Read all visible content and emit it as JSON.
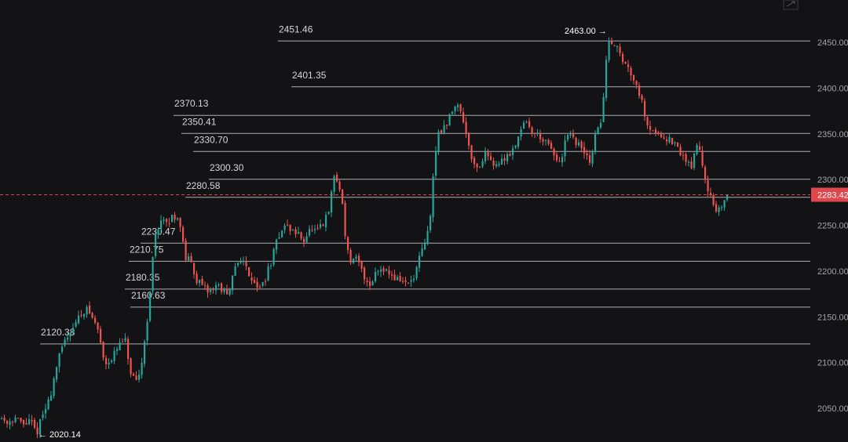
{
  "chart_data": {
    "type": "candlestick",
    "ylim": [
      2020,
      2470
    ],
    "y_ticks": [
      "2050.00",
      "2100.00",
      "2150.00",
      "2200.00",
      "2250.00",
      "2300.00",
      "2350.00",
      "2400.00",
      "2450.00"
    ],
    "horizontal_levels": [
      {
        "label": "2451.46",
        "value": 2451.46
      },
      {
        "label": "2401.35",
        "value": 2401.35
      },
      {
        "label": "2370.13",
        "value": 2370.13
      },
      {
        "label": "2350.41",
        "value": 2350.41
      },
      {
        "label": "2330.70",
        "value": 2330.7
      },
      {
        "label": "2300.30",
        "value": 2300.3
      },
      {
        "label": "2280.58",
        "value": 2280.58
      },
      {
        "label": "2230.47",
        "value": 2230.47
      },
      {
        "label": "2210.75",
        "value": 2210.75
      },
      {
        "label": "2180.35",
        "value": 2180.35
      },
      {
        "label": "2160.63",
        "value": 2160.63
      },
      {
        "label": "2120.38",
        "value": 2120.38
      }
    ],
    "current_price": {
      "label": "2283.42",
      "value": 2283.42
    },
    "high_marker": {
      "label": "2463.00",
      "arrow": "→",
      "value": 2463.0
    },
    "low_marker": {
      "label": "2020.14",
      "arrow": "←",
      "value": 2020.14
    },
    "price_path": [
      [
        0,
        2040
      ],
      [
        8,
        2035
      ],
      [
        18,
        2040
      ],
      [
        28,
        2032
      ],
      [
        38,
        2036
      ],
      [
        45,
        2022
      ],
      [
        52,
        2040
      ],
      [
        62,
        2060
      ],
      [
        72,
        2100
      ],
      [
        82,
        2125
      ],
      [
        92,
        2140
      ],
      [
        100,
        2150
      ],
      [
        108,
        2160
      ],
      [
        116,
        2150
      ],
      [
        124,
        2135
      ],
      [
        132,
        2100
      ],
      [
        142,
        2105
      ],
      [
        150,
        2118
      ],
      [
        158,
        2125
      ],
      [
        166,
        2085
      ],
      [
        174,
        2075
      ],
      [
        182,
        2115
      ],
      [
        190,
        2175
      ],
      [
        196,
        2240
      ],
      [
        204,
        2255
      ],
      [
        212,
        2250
      ],
      [
        220,
        2262
      ],
      [
        228,
        2255
      ],
      [
        234,
        2215
      ],
      [
        242,
        2210
      ],
      [
        250,
        2190
      ],
      [
        258,
        2180
      ],
      [
        266,
        2178
      ],
      [
        274,
        2185
      ],
      [
        282,
        2180
      ],
      [
        290,
        2170
      ],
      [
        298,
        2205
      ],
      [
        306,
        2215
      ],
      [
        314,
        2200
      ],
      [
        322,
        2190
      ],
      [
        330,
        2180
      ],
      [
        338,
        2195
      ],
      [
        346,
        2215
      ],
      [
        354,
        2240
      ],
      [
        362,
        2250
      ],
      [
        370,
        2245
      ],
      [
        378,
        2240
      ],
      [
        386,
        2235
      ],
      [
        394,
        2245
      ],
      [
        402,
        2242
      ],
      [
        410,
        2250
      ],
      [
        418,
        2265
      ],
      [
        424,
        2305
      ],
      [
        430,
        2295
      ],
      [
        436,
        2270
      ],
      [
        440,
        2225
      ],
      [
        446,
        2210
      ],
      [
        454,
        2212
      ],
      [
        462,
        2195
      ],
      [
        470,
        2185
      ],
      [
        478,
        2200
      ],
      [
        486,
        2205
      ],
      [
        494,
        2198
      ],
      [
        502,
        2192
      ],
      [
        510,
        2190
      ],
      [
        518,
        2185
      ],
      [
        526,
        2192
      ],
      [
        532,
        2210
      ],
      [
        540,
        2230
      ],
      [
        546,
        2250
      ],
      [
        552,
        2320
      ],
      [
        558,
        2355
      ],
      [
        566,
        2355
      ],
      [
        574,
        2375
      ],
      [
        582,
        2385
      ],
      [
        590,
        2360
      ],
      [
        596,
        2340
      ],
      [
        602,
        2315
      ],
      [
        610,
        2315
      ],
      [
        618,
        2330
      ],
      [
        626,
        2320
      ],
      [
        634,
        2315
      ],
      [
        642,
        2325
      ],
      [
        650,
        2330
      ],
      [
        658,
        2345
      ],
      [
        666,
        2365
      ],
      [
        674,
        2355
      ],
      [
        682,
        2350
      ],
      [
        690,
        2345
      ],
      [
        698,
        2335
      ],
      [
        706,
        2325
      ],
      [
        714,
        2315
      ],
      [
        720,
        2350
      ],
      [
        726,
        2345
      ],
      [
        734,
        2340
      ],
      [
        742,
        2330
      ],
      [
        750,
        2320
      ],
      [
        758,
        2350
      ],
      [
        766,
        2370
      ],
      [
        770,
        2425
      ],
      [
        776,
        2455
      ],
      [
        784,
        2445
      ],
      [
        792,
        2430
      ],
      [
        800,
        2420
      ],
      [
        808,
        2410
      ],
      [
        816,
        2385
      ],
      [
        824,
        2360
      ],
      [
        832,
        2352
      ],
      [
        840,
        2350
      ],
      [
        848,
        2345
      ],
      [
        856,
        2340
      ],
      [
        864,
        2330
      ],
      [
        872,
        2322
      ],
      [
        880,
        2315
      ],
      [
        888,
        2342
      ],
      [
        896,
        2305
      ],
      [
        904,
        2280
      ],
      [
        912,
        2260
      ],
      [
        918,
        2272
      ],
      [
        924,
        2283
      ],
      [
        928,
        2283
      ]
    ]
  }
}
